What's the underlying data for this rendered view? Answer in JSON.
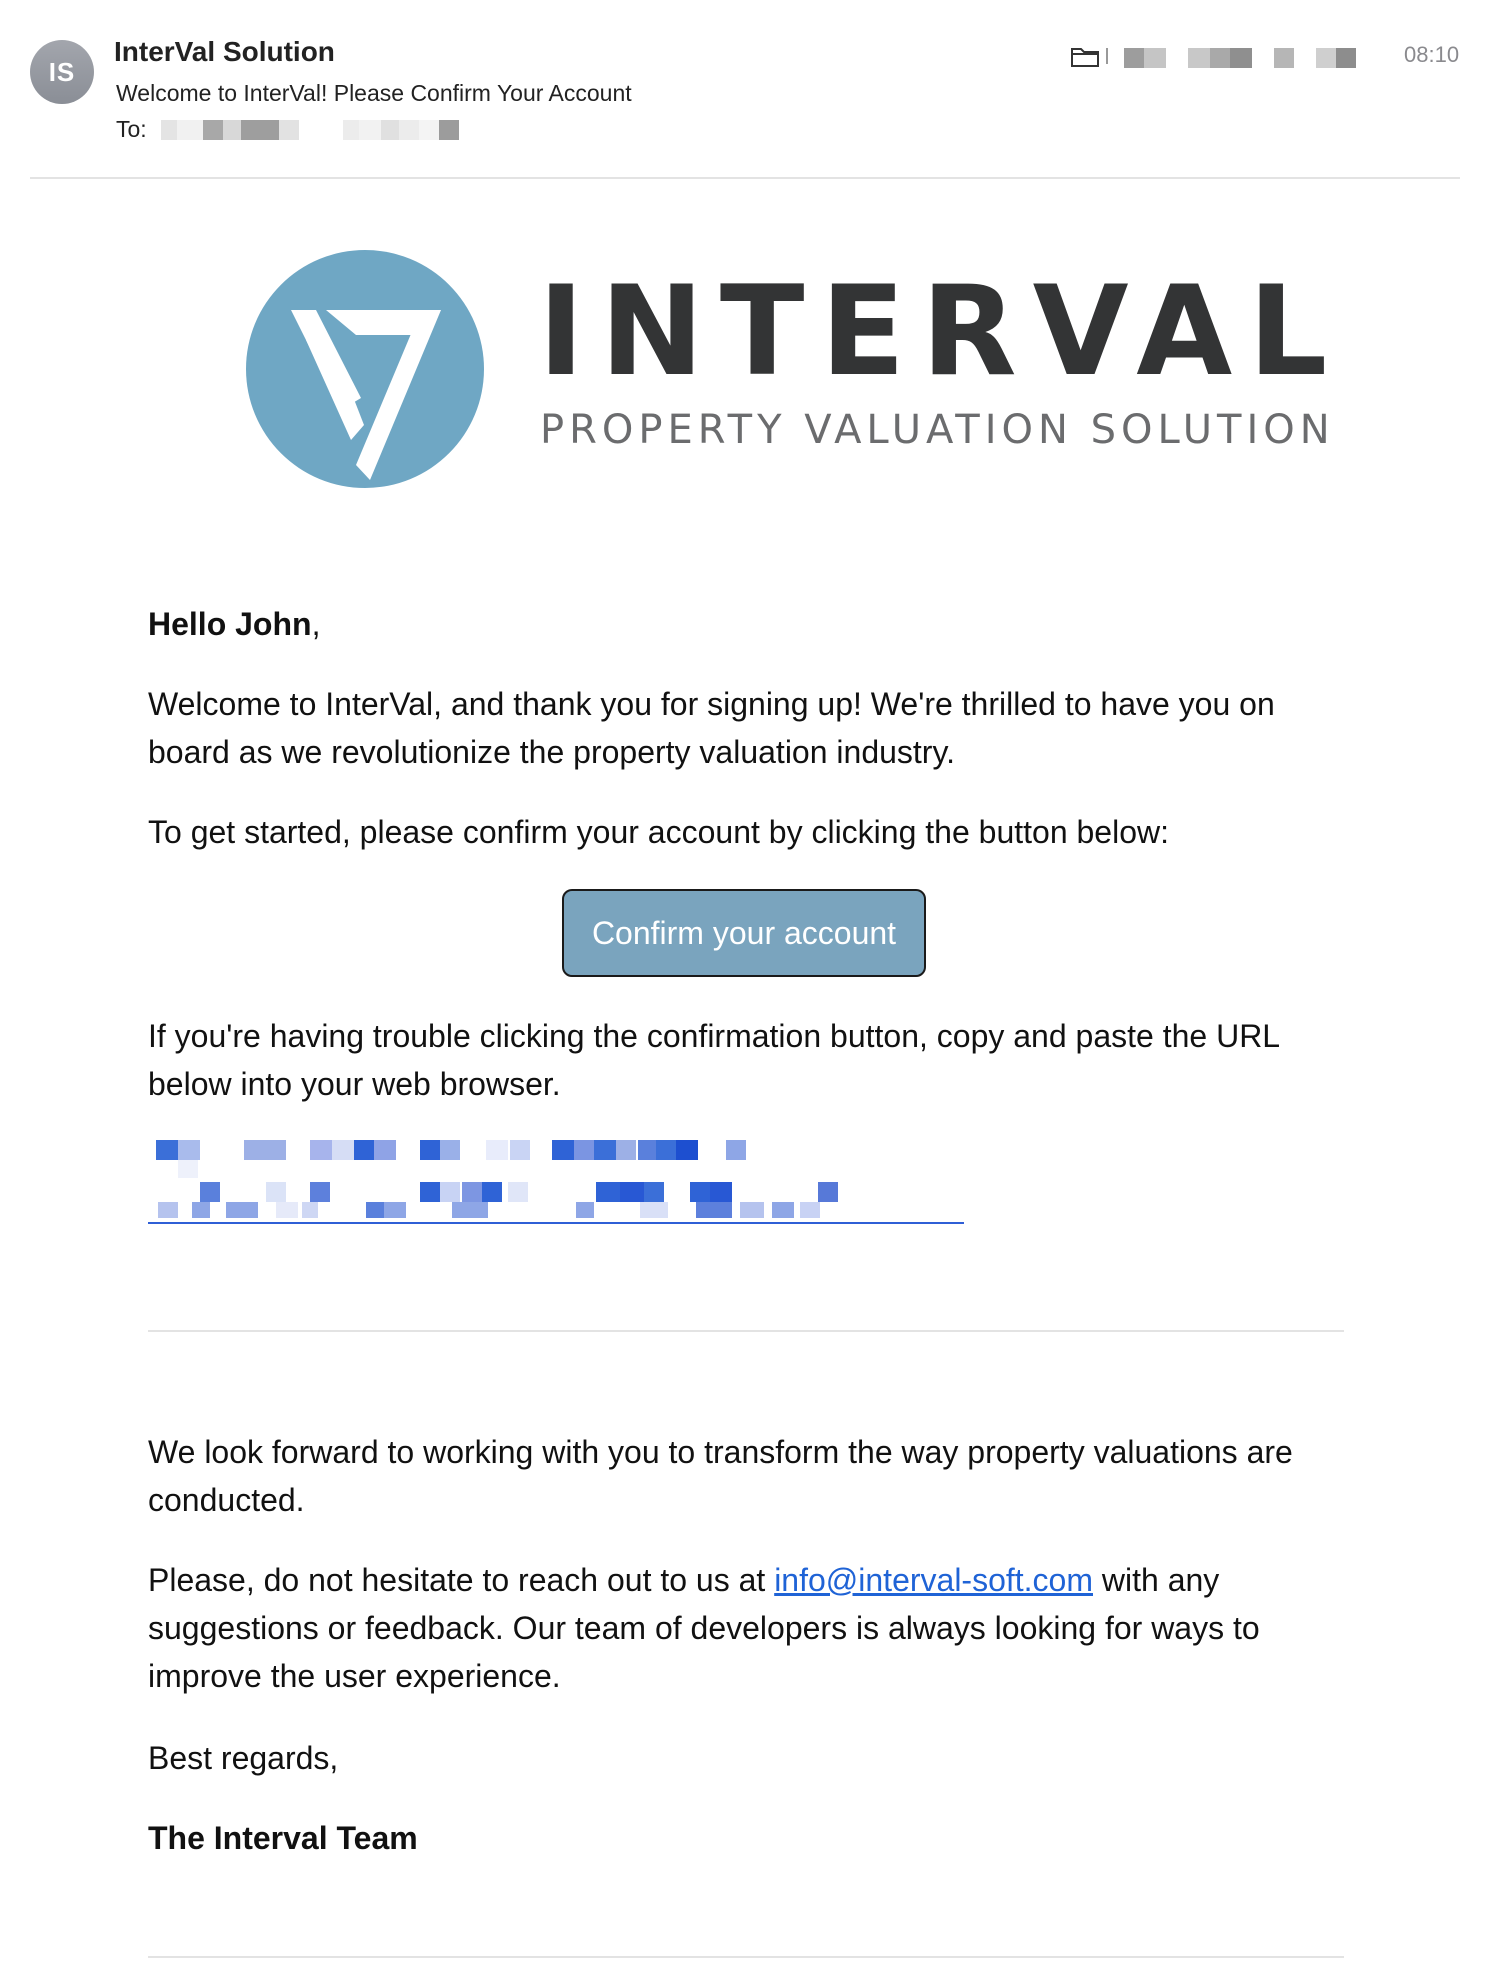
{
  "header": {
    "avatar_initials": "IS",
    "sender_name": "InterVal Solution",
    "subject": "Welcome to InterVal! Please Confirm Your Account",
    "to_label": "To:",
    "time": "08:10"
  },
  "logo": {
    "wordmark": "INTERVAL",
    "tagline": "PROPERTY VALUATION SOLUTION",
    "circle_color": "#6fa7c4",
    "text_color": "#333435"
  },
  "body": {
    "greeting_name": "Hello John",
    "greeting_punct": ",",
    "p1": "Welcome to InterVal, and thank you for signing up! We're thrilled to have you on board as we revolutionize the property valuation industry.",
    "p2": "To get started, please confirm your account by clicking the button below:",
    "confirm_button": "Confirm your account",
    "p3": "If you're having trouble clicking the confirmation button, copy and paste the URL below into your web browser.",
    "p4": "We look forward to working with you to transform the way property valuations are conducted.",
    "p5_before": "Please, do not hesitate to reach out to us at ",
    "p5_email": "info@interval-soft.com",
    "p5_after": " with any suggestions or feedback. Our team of developers is always looking for ways to improve the user experience.",
    "p6": "Best regards,",
    "signature": "The Interval Team"
  },
  "colors": {
    "button_bg": "#7aa4be",
    "link": "#1f63d6"
  },
  "icons": {
    "folder": "folder-icon"
  }
}
